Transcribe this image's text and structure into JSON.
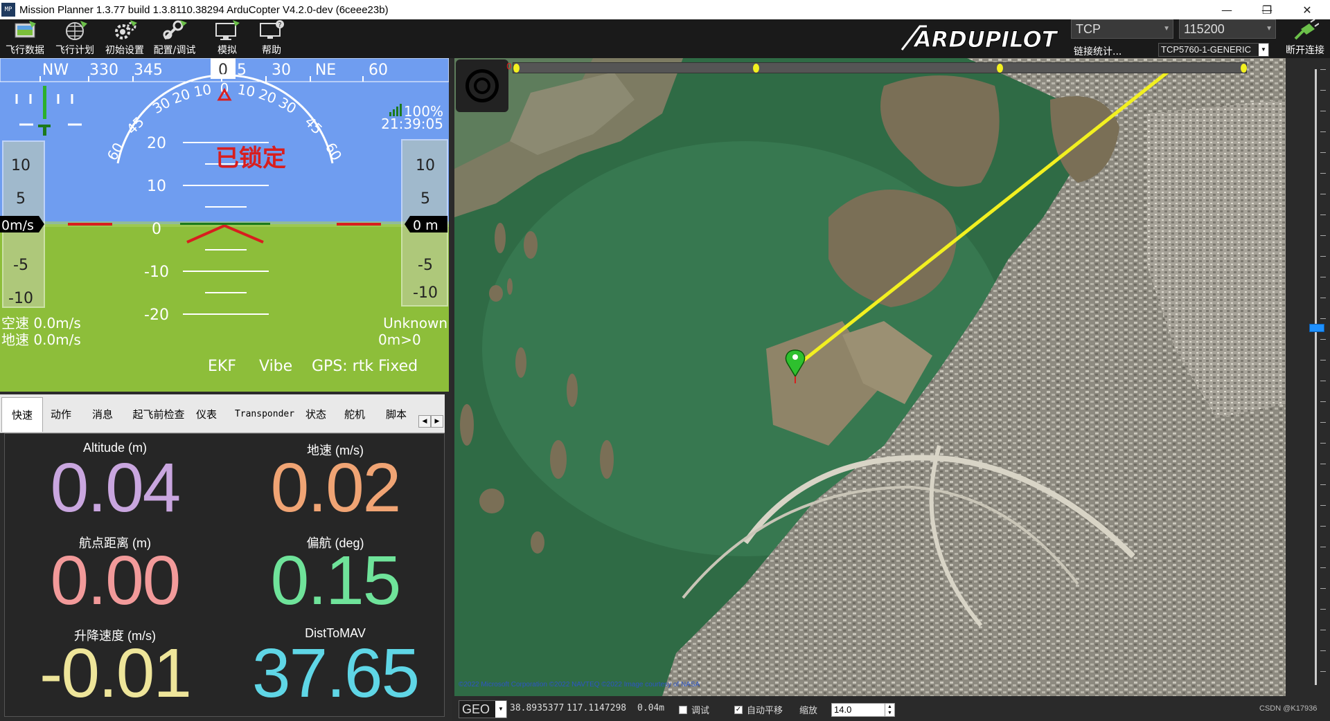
{
  "window": {
    "title": "Mission Planner 1.3.77 build 1.3.8110.38294 ArduCopter V4.2.0-dev (6ceee23b)",
    "app_icon": "MP",
    "minimize": "—",
    "restore": "❐",
    "close": "✕"
  },
  "toolbar": {
    "buttons": [
      {
        "label": "飞行数据",
        "icon": "flight-data-icon"
      },
      {
        "label": "飞行计划",
        "icon": "flight-plan-icon"
      },
      {
        "label": "初始设置",
        "icon": "initial-setup-icon"
      },
      {
        "label": "配置/调试",
        "icon": "config-tuning-icon"
      },
      {
        "label": "模拟",
        "icon": "simulation-icon"
      },
      {
        "label": "帮助",
        "icon": "help-icon"
      }
    ],
    "logo_text": "ARDUPILOT",
    "connection_type": "TCP",
    "baud_rate": "115200",
    "link_stats": "链接统计...",
    "device": "TCP5760-1-GENERIC",
    "disconnect_label": "断开连接"
  },
  "hud": {
    "heading_ticks": [
      "NW",
      "330",
      "345",
      "0",
      "15",
      "30",
      "NE",
      "60"
    ],
    "roll_ticks": [
      "60",
      "45",
      "30",
      "20",
      "10",
      "0",
      "10",
      "20",
      "30",
      "45",
      "60"
    ],
    "pitch_ticks": [
      "20",
      "10",
      "0",
      "-10",
      "-20"
    ],
    "speed_ticks": [
      "10",
      "5",
      "0",
      "-5",
      "-10"
    ],
    "alt_ticks": [
      "10",
      "5",
      "-5",
      "-10"
    ],
    "speed_readout": "0m/s",
    "alt_readout": "0 m",
    "armed_status": "已锁定",
    "signal": "100%",
    "time": "21:39:05",
    "airspeed": "空速 0.0m/s",
    "groundspeed": "地速 0.0m/s",
    "mode": "Unknown",
    "wp_dist": "0m>0",
    "ekf": "EKF",
    "vibe": "Vibe",
    "gps": "GPS: rtk Fixed",
    "colors": {
      "sky": "#6f9df0",
      "ground": "#8dbe3a",
      "warn": "#d81e1e"
    }
  },
  "tabs": [
    {
      "label": "快速",
      "active": true
    },
    {
      "label": "动作"
    },
    {
      "label": "消息"
    },
    {
      "label": "起飞前检查"
    },
    {
      "label": "仪表"
    },
    {
      "label": "Transponder"
    },
    {
      "label": "状态"
    },
    {
      "label": "舵机"
    },
    {
      "label": "脚本"
    }
  ],
  "tab_nav": {
    "prev": "◀",
    "next": "▶"
  },
  "quick": [
    {
      "label": "Altitude (m)",
      "value": "0.04",
      "color": "#c9a6df"
    },
    {
      "label": "地速 (m/s)",
      "value": "0.02",
      "color": "#f0a474"
    },
    {
      "label": "航点距离 (m)",
      "value": "0.00",
      "color": "#f29a9a"
    },
    {
      "label": "偏航 (deg)",
      "value": "0.15",
      "color": "#6fe39a"
    },
    {
      "label": "升降速度 (m/s)",
      "value": "-0.01",
      "color": "#eee59a"
    },
    {
      "label": "DistToMAV",
      "value": "37.65",
      "color": "#5fd6e6"
    }
  ],
  "map": {
    "timeline_start": "0",
    "attribution": "©2022 Microsoft Corporation ©2022 NAVTEQ ©2022 Image courtesy of NASA",
    "watermark": "CSDN @K17936",
    "marker": "home-marker-icon"
  },
  "statusbar": {
    "coord_system": "GEO",
    "lat": "38.8935377",
    "lon": "117.1147298",
    "alt": "0.04m",
    "debug_label": "调试",
    "debug_checked": false,
    "autopan_label": "自动平移",
    "autopan_checked": true,
    "zoom_label": "缩放",
    "zoom_value": "14.0"
  }
}
